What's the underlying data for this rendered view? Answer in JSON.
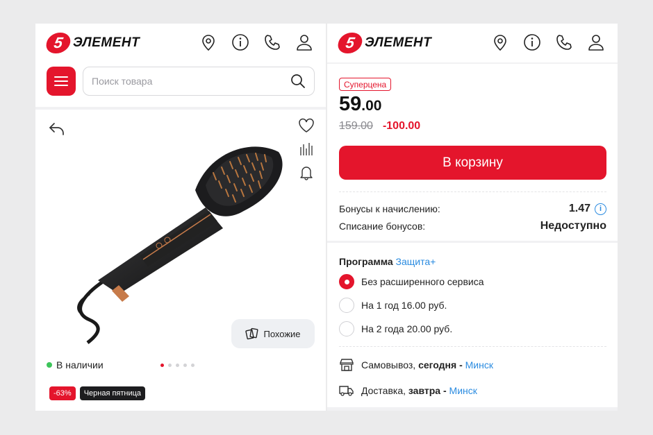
{
  "brand": {
    "badge": "5",
    "name": "ЭЛЕМЕНТ"
  },
  "colors": {
    "accent": "#e4152c",
    "link": "#2a8be0",
    "in_stock": "#3cc45a"
  },
  "left": {
    "search_placeholder": "Поиск товара",
    "similar_label": "Похожие",
    "stock_label": "В наличии",
    "tags": [
      "-63%",
      "Черная пятница"
    ],
    "gallery": {
      "images": 5,
      "active_index": 0
    }
  },
  "right": {
    "badge": "Суперцена",
    "price_int": "59",
    "price_dec": ".00",
    "old_price": "159.00",
    "discount": "-100.00",
    "cart_label": "В корзину",
    "bonus_label": "Бонусы к начислению:",
    "bonus_value": "1.47",
    "writeoff_label": "Списание бонусов:",
    "writeoff_value": "Недоступно",
    "program_label": "Программа",
    "program_link": "Защита+",
    "options": [
      {
        "label": "Без расширенного сервиса",
        "selected": true
      },
      {
        "label": "На 1 год 16.00 руб.",
        "selected": false
      },
      {
        "label": "На 2 года 20.00 руб.",
        "selected": false
      }
    ],
    "pickup_text": "Самовывоз, ",
    "pickup_when": "сегодня",
    "pickup_sep": " - ",
    "pickup_city": "Минск",
    "delivery_text": "Доставка, ",
    "delivery_when": "завтра",
    "delivery_sep": " - ",
    "delivery_city": "Минск"
  },
  "icons": [
    "location-pin-icon",
    "info-icon",
    "phone-icon",
    "user-icon",
    "menu-icon",
    "search-icon",
    "back-arrow-icon",
    "heart-icon",
    "compare-icon",
    "bell-icon",
    "similar-cards-icon",
    "store-icon",
    "truck-icon"
  ]
}
